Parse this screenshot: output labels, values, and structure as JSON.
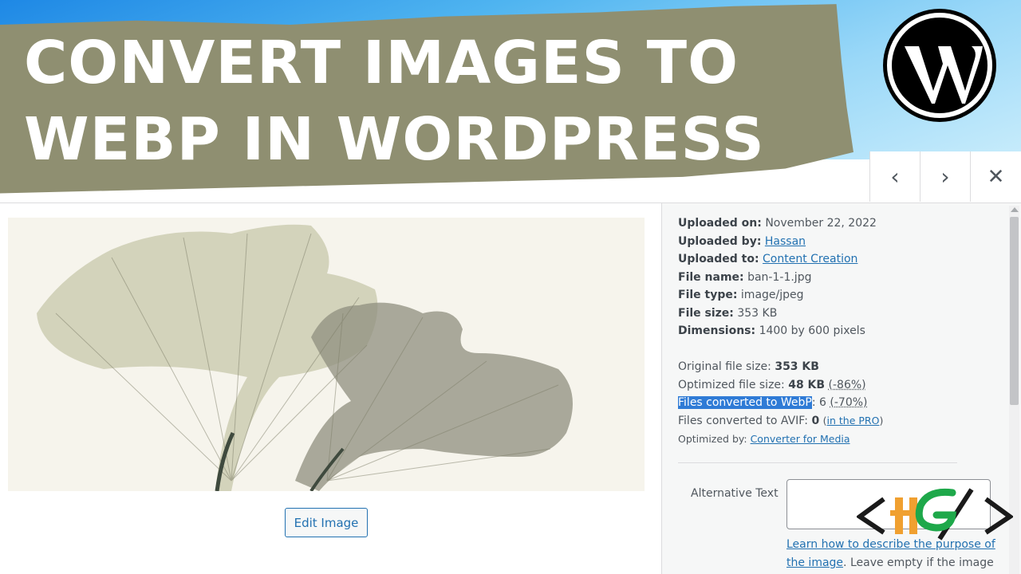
{
  "banner": {
    "line1": "CONVERT IMAGES TO",
    "line2": "WEBP IN WORDPRESS"
  },
  "nav": {
    "prev": "‹",
    "next": "›",
    "close": "✕"
  },
  "actions": {
    "edit_image": "Edit Image"
  },
  "details": {
    "uploaded_on_label": "Uploaded on:",
    "uploaded_on": "November 22, 2022",
    "uploaded_by_label": "Uploaded by:",
    "uploaded_by": "Hassan",
    "uploaded_to_label": "Uploaded to:",
    "uploaded_to": "Content Creation",
    "file_name_label": "File name:",
    "file_name": "ban-1-1.jpg",
    "file_type_label": "File type:",
    "file_type": "image/jpeg",
    "file_size_label": "File size:",
    "file_size": "353 KB",
    "dimensions_label": "Dimensions:",
    "dimensions": "1400 by 600 pixels"
  },
  "optimization": {
    "original_label": "Original file size:",
    "original": "353 KB",
    "optimized_label": "Optimized file size:",
    "optimized": "48 KB",
    "optimized_saving": "(-86%)",
    "webp_label": "Files converted to WebP",
    "webp_count": "6",
    "webp_saving": "(-70%)",
    "avif_label": "Files converted to AVIF:",
    "avif_count": "0",
    "avif_link": "in the PRO",
    "optimized_by_label": "Optimized by:",
    "optimized_by": "Converter for Media"
  },
  "alt_text": {
    "label": "Alternative Text",
    "value": "",
    "help_link": "Learn how to describe the purpose of the image",
    "help_rest": ". Leave empty if the image is"
  },
  "icons": {
    "wordpress": "wordpress-logo-icon",
    "prev": "chevron-left-icon",
    "next": "chevron-right-icon",
    "close": "close-icon",
    "watermark": "channel-logo-icon"
  },
  "colors": {
    "banner_olive": "#8f8f71",
    "link": "#2271b1",
    "selection": "#2f7bd6"
  }
}
